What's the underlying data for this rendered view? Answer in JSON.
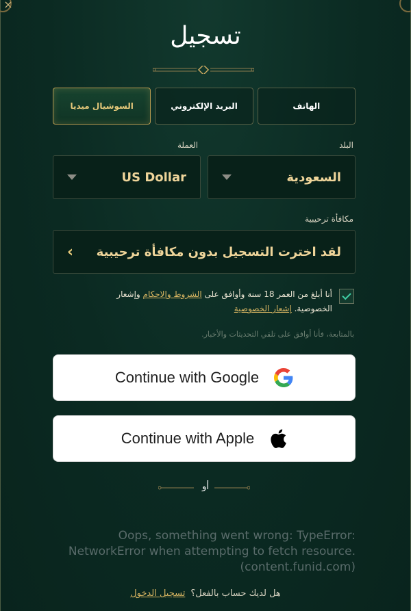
{
  "title": "تسجيل",
  "tabs": [
    {
      "label": "الهاتف",
      "active": false
    },
    {
      "label": "البريد الإلكتروني",
      "active": false
    },
    {
      "label": "السوشيال ميديا",
      "active": true
    }
  ],
  "country": {
    "label": "البلد",
    "value": "السعودية"
  },
  "currency": {
    "label": "العملة",
    "value": "US Dollar"
  },
  "bonus": {
    "label": "مكافأة ترحيبية",
    "value": "لقد اخترت التسجيل بدون مكافأة ترحيبية"
  },
  "terms": {
    "checked": true,
    "part1": "أنا أبلغ من العمر 18 سنة وأوافق على ",
    "terms_link": "الشروط والاحكام",
    "part2": " وإشعار الخصوصية. ",
    "privacy_link": "إشعار الخصوصية"
  },
  "newsletter": "بالمتابعة، فأنا أوافق على تلقي التحديثات والأخبار.",
  "google_button": "Continue with Google",
  "apple_button": "Continue with Apple",
  "or_label": "أو",
  "error_message": "Oops, something went wrong: TypeError: NetworkError when attempting to fetch resource. (content.funid.com)",
  "footer": {
    "question": "هل لديك حساب بالفعل؟",
    "login_link": "تسجيل الدخول"
  },
  "colors": {
    "background": "#0b2a22",
    "accent": "#d9b662",
    "check": "#3fd0a6"
  }
}
